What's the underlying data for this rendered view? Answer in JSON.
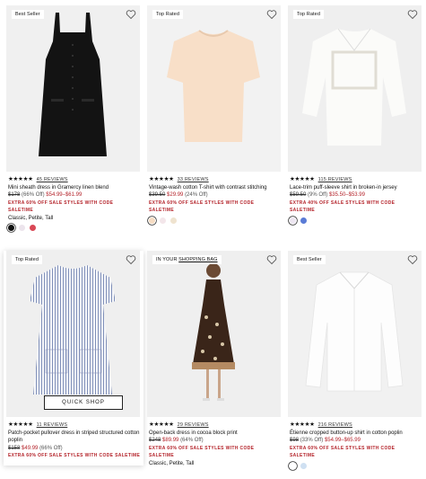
{
  "products": [
    {
      "badge": "Best Seller",
      "stars": "★★★★★",
      "reviews": "45 REVIEWS",
      "name": "Mini sheath dress in Gramercy linen blend",
      "price_orig": "$178",
      "price_off": "(66% Off)",
      "price_sale": "$54.99–$61.99",
      "promo": "EXTRA 60% OFF SALE STYLES WITH CODE SALETIME",
      "fits": "Classic, Petite, Tall",
      "swatches": [
        "#111111",
        "#ece4ec",
        "#d94856"
      ],
      "quick_shop": ""
    },
    {
      "badge": "Top Rated",
      "stars": "★★★★★",
      "reviews": "33 REVIEWS",
      "name": "Vintage-wash cotton T-shirt with contrast stitching",
      "price_orig": "$39.50",
      "price_off": "(24% Off)",
      "price_sale": "$29.99",
      "promo": "EXTRA 60% OFF SALE STYLES WITH CODE SALETIME",
      "fits": "",
      "swatches": [
        "#f6dcc3",
        "#f3e6ea",
        "#efe3cf"
      ],
      "quick_shop": ""
    },
    {
      "badge": "Top Rated",
      "stars": "★★★★★",
      "reviews": "115 REVIEWS",
      "name": "Lace-trim puff-sleeve shirt in broken-in jersey",
      "price_orig": "$59.50",
      "price_off": "(9% Off)",
      "price_sale": "$35.50–$53.99",
      "promo": "EXTRA 40% OFF SALE STYLES WITH CODE SALETIME",
      "fits": "",
      "swatches": [
        "#ede6f1",
        "#5a7bd6"
      ],
      "quick_shop": ""
    },
    {
      "badge": "Top Rated",
      "stars": "★★★★★",
      "reviews": "11 REVIEWS",
      "name": "Patch-pocket pullover dress in striped structured cotton poplin",
      "price_orig": "$158",
      "price_off": "(66% Off)",
      "price_sale": "$49.99",
      "promo": "EXTRA 60% OFF SALE STYLES WITH CODE SALETIME",
      "fits": "",
      "swatches": [],
      "quick_shop": "QUICK SHOP"
    },
    {
      "badge_prefix": "IN YOUR ",
      "badge": "SHOPPING BAG",
      "stars": "★★★★★",
      "reviews": "29 REVIEWS",
      "name": "Open-back dress in cocoa block print",
      "price_orig": "$248",
      "price_off": "(64% Off)",
      "price_sale": "$89.99",
      "promo": "EXTRA 60% OFF SALE STYLES WITH CODE SALETIME",
      "fits": "Classic, Petite, Tall",
      "swatches": [],
      "quick_shop": ""
    },
    {
      "badge": "Best Seller",
      "stars": "★★★★★",
      "reviews": "216 REVIEWS",
      "name": "Étienne cropped button-up shirt in cotton poplin",
      "price_orig": "$98",
      "price_off": "(33% Off)",
      "price_sale": "$54.99–$65.99",
      "promo": "EXTRA 60% OFF SALE STYLES WITH CODE SALETIME",
      "fits": "",
      "swatches": [
        "#ffffff",
        "#cfe0f2"
      ],
      "quick_shop": ""
    }
  ],
  "icons": {
    "heart": "heart-outline-icon",
    "star": "star-icon"
  },
  "colors": {
    "sale_red": "#b4232a",
    "image_bg": "#f1f1f1"
  }
}
